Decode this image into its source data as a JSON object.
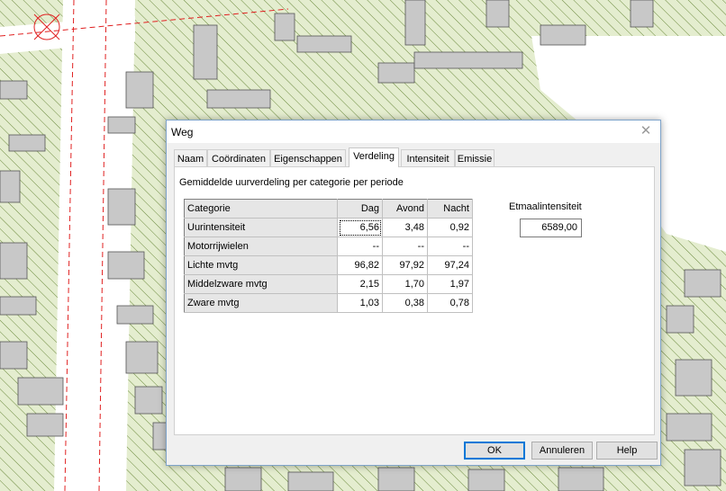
{
  "dialog": {
    "title": "Weg",
    "close_glyph": "✕",
    "tabs": [
      {
        "label": "Naam"
      },
      {
        "label": "Coördinaten"
      },
      {
        "label": "Eigenschappen"
      },
      {
        "label": "Verdeling",
        "active": true
      },
      {
        "label": "Intensiteit"
      },
      {
        "label": "Emissie"
      }
    ],
    "caption": "Gemiddelde uurverdeling per categorie per periode",
    "table": {
      "headers": [
        "Categorie",
        "Dag",
        "Avond",
        "Nacht"
      ],
      "rows": [
        [
          "Uurintensiteit",
          "6,56",
          "3,48",
          "0,92"
        ],
        [
          "Motorrijwielen",
          "--",
          "--",
          "--"
        ],
        [
          "Lichte mvtg",
          "96,82",
          "97,92",
          "97,24"
        ],
        [
          "Middelzware mvtg",
          "2,15",
          "1,70",
          "1,97"
        ],
        [
          "Zware mvtg",
          "1,03",
          "0,38",
          "0,78"
        ]
      ]
    },
    "etmaal_label": "Etmaalintensiteit",
    "etmaal_value": "6589,00",
    "buttons": {
      "ok": "OK",
      "cancel": "Annuleren",
      "help": "Help"
    }
  },
  "colors": {
    "map_background": "#e4edcf",
    "hatch": "#6c8a3e",
    "building_fill": "#c8c8c8",
    "road_marking": "#e02020",
    "dialog_accent": "#0078d7"
  }
}
